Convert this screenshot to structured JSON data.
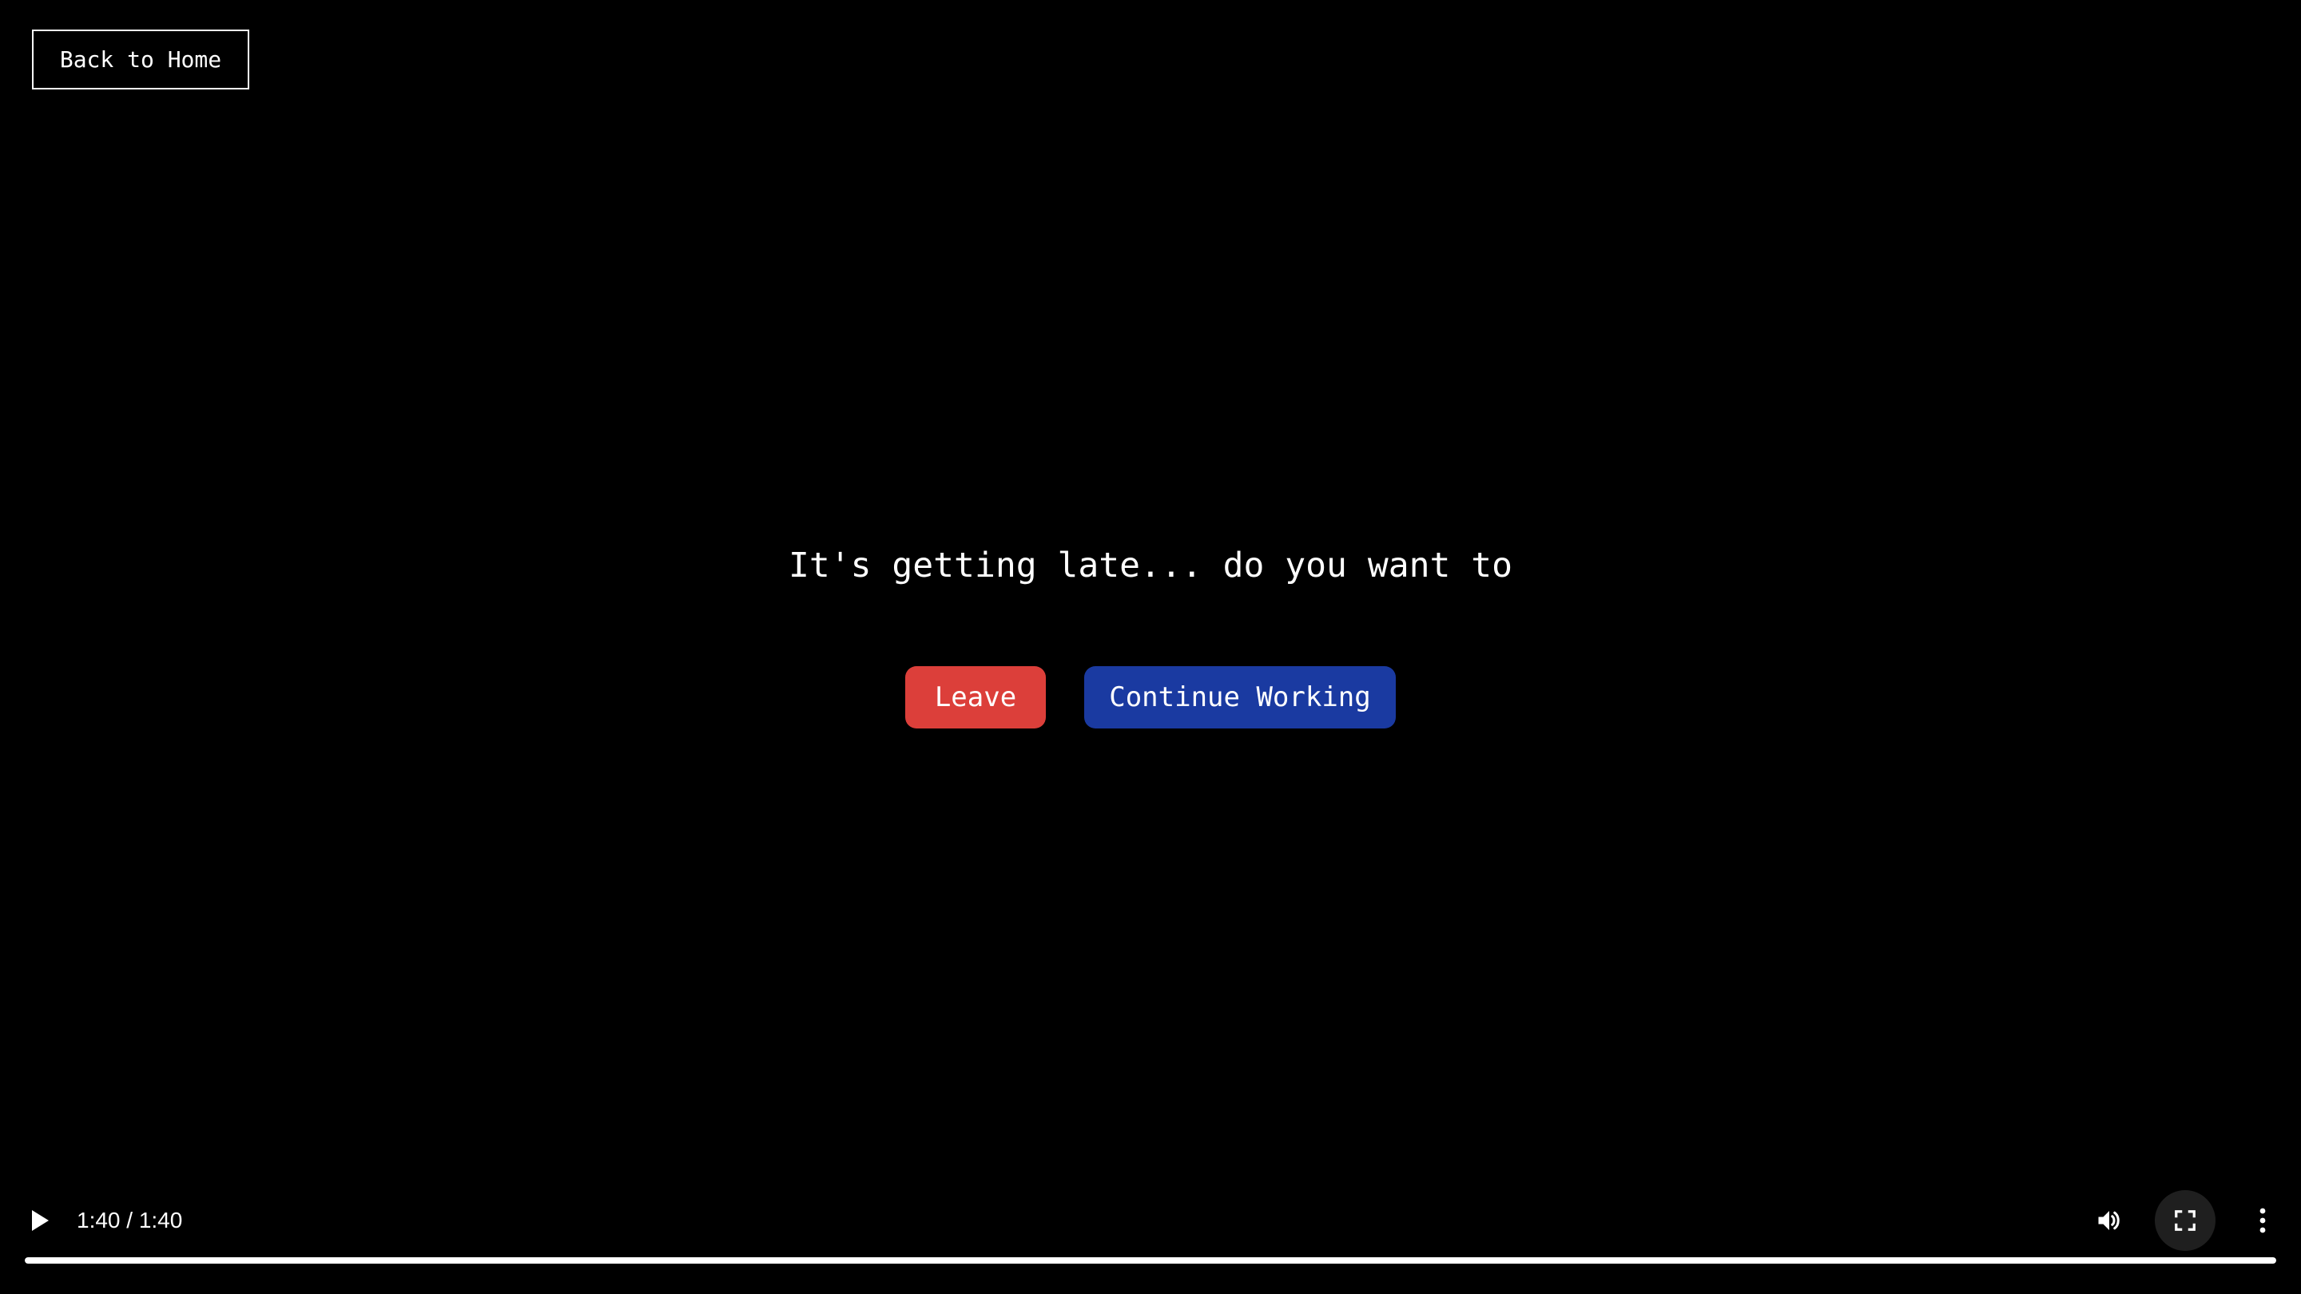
{
  "nav": {
    "back_label": "Back to Home"
  },
  "scene": {
    "prompt": "It's getting late... do you want to",
    "choices": [
      {
        "label": "Leave",
        "color": "#dc3f3a"
      },
      {
        "label": "Continue Working",
        "color": "#1a3aa1"
      }
    ]
  },
  "player": {
    "time_display": "1:40 / 1:40",
    "progress_fraction": 1.0,
    "icons": {
      "play": "play-icon",
      "volume": "volume-icon",
      "fullscreen": "fullscreen-icon",
      "more": "more-vertical-icon"
    }
  },
  "colors": {
    "background": "#000000",
    "text": "#ffffff",
    "progress": "#ffffff"
  }
}
